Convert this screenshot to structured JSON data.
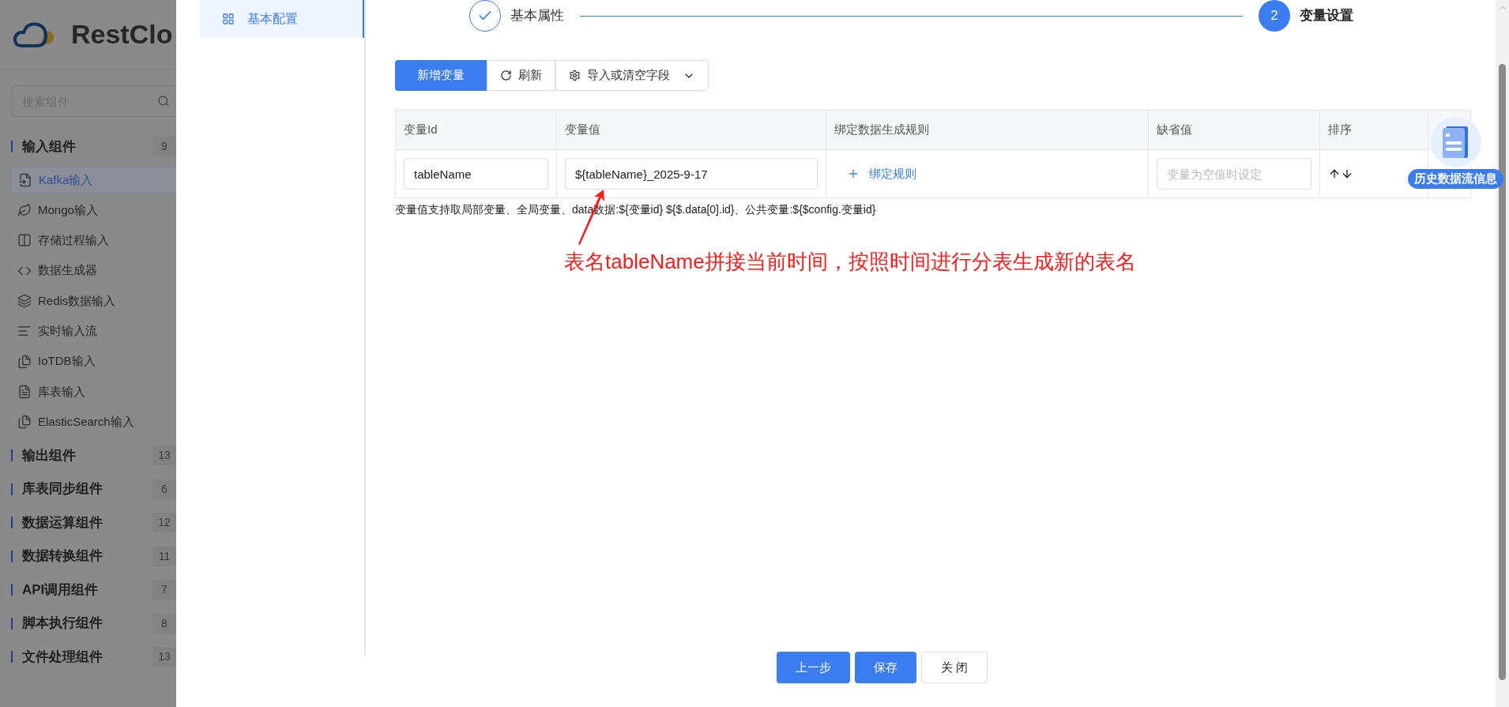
{
  "sidebar": {
    "logo": "RestClo",
    "search": {
      "placeholder": "搜索组件"
    },
    "groups": [
      {
        "label": "输入组件",
        "count": "9",
        "expanded": true,
        "items": [
          {
            "label": "Kafka输入",
            "selected": true
          },
          {
            "label": "Mongo输入",
            "selected": false
          },
          {
            "label": "存储过程输入",
            "selected": false
          },
          {
            "label": "数据生成器",
            "selected": false
          },
          {
            "label": "Redis数据输入",
            "selected": false
          },
          {
            "label": "实时输入流",
            "selected": false
          },
          {
            "label": "IoTDB输入",
            "selected": false
          },
          {
            "label": "库表输入",
            "selected": false
          },
          {
            "label": "ElasticSearch输入",
            "selected": false
          }
        ]
      },
      {
        "label": "输出组件",
        "count": "13",
        "expanded": false
      },
      {
        "label": "库表同步组件",
        "count": "6",
        "expanded": false
      },
      {
        "label": "数据运算组件",
        "count": "12",
        "expanded": false
      },
      {
        "label": "数据转换组件",
        "count": "11",
        "expanded": false
      },
      {
        "label": "API调用组件",
        "count": "7",
        "expanded": false
      },
      {
        "label": "脚本执行组件",
        "count": "8",
        "expanded": false
      },
      {
        "label": "文件处理组件",
        "count": "13",
        "expanded": false
      }
    ]
  },
  "modal": {
    "nav": [
      {
        "label": "基本配置",
        "selected": true
      }
    ],
    "steps": [
      {
        "label": "基本属性",
        "done": true
      },
      {
        "label": "变量设置",
        "done": false,
        "number": "2"
      }
    ],
    "toolbar": [
      {
        "label": "新增变量",
        "kind": "primary"
      },
      {
        "label": "刷新",
        "kind": "refresh"
      },
      {
        "label": "导入或清空字段",
        "kind": "dropdown"
      }
    ],
    "table": {
      "columns": [
        "变量Id",
        "变量值",
        "绑定数据生成规则",
        "缺省值",
        "排序"
      ],
      "rows": [
        {
          "id": "tableName",
          "value": "${tableName}_2025-9-17",
          "rule": "绑定规则",
          "default_placeholder": "变量为空值时设定"
        }
      ]
    },
    "help": "变量值支持取局部变量、全局变量、data数据:${变量id} ${$.data[0].id}、公共变量:${$config.变量id}",
    "annotation": "表名tableName拼接当前时间，按照时间进行分表生成新的表名",
    "footer": [
      {
        "label": "上一步",
        "primary": true
      },
      {
        "label": "保存",
        "primary": true
      },
      {
        "label": "关 闭",
        "primary": false
      }
    ],
    "floating": {
      "label": "历史数据流信息"
    }
  }
}
